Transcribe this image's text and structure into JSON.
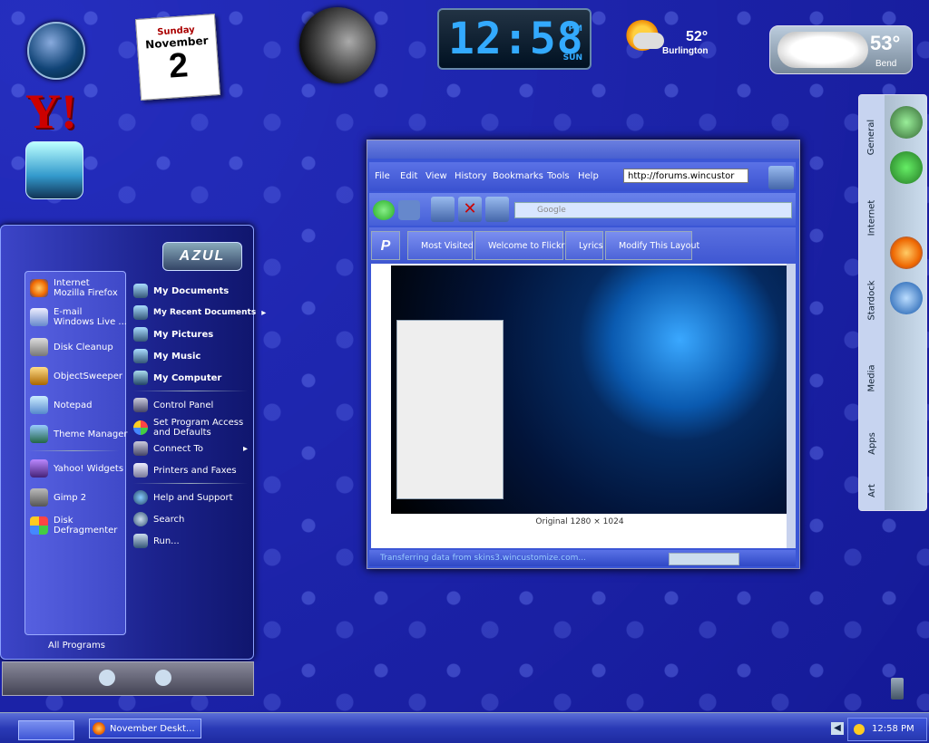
{
  "calendar": {
    "weekday": "Sunday",
    "month": "November",
    "day": "2"
  },
  "clock": {
    "time": "12:58",
    "ampm": "PM",
    "weekday": "SUN"
  },
  "weather_small": {
    "temp": "52°",
    "city": "Burlington"
  },
  "weather_large": {
    "temp": "53°",
    "city": "Bend"
  },
  "start_menu": {
    "logo": "AZUL",
    "left_items": [
      {
        "line1": "Internet",
        "line2": "Mozilla Firefox"
      },
      {
        "line1": "E-mail",
        "line2": "Windows Live ..."
      },
      {
        "line1": "Disk Cleanup",
        "line2": ""
      },
      {
        "line1": "ObjectSweeper",
        "line2": ""
      },
      {
        "line1": "Notepad",
        "line2": ""
      },
      {
        "line1": "Theme Manager",
        "line2": ""
      },
      {
        "line1": "Yahoo! Widgets",
        "line2": ""
      },
      {
        "line1": "Gimp 2",
        "line2": ""
      },
      {
        "line1": "Disk",
        "line2": "Defragmenter"
      }
    ],
    "all_programs": "All Programs",
    "right_items": [
      {
        "label": "My Documents",
        "arrow": ""
      },
      {
        "label": "My Recent Documents",
        "arrow": "▸"
      },
      {
        "label": "My Pictures",
        "arrow": ""
      },
      {
        "label": "My Music",
        "arrow": ""
      },
      {
        "label": "My Computer",
        "arrow": ""
      },
      {
        "label": "Control Panel",
        "arrow": ""
      },
      {
        "label": "Set Program Access",
        "line2": "and Defaults",
        "arrow": ""
      },
      {
        "label": "Connect To",
        "arrow": "▸"
      },
      {
        "label": "Printers and Faxes",
        "arrow": ""
      },
      {
        "label": "Help and Support",
        "arrow": ""
      },
      {
        "label": "Search",
        "arrow": ""
      },
      {
        "label": "Run...",
        "arrow": ""
      }
    ]
  },
  "browser": {
    "menu": [
      "File",
      "Edit",
      "View",
      "History",
      "Bookmarks",
      "Tools",
      "Help"
    ],
    "url": "http://forums.wincustor",
    "search_placeholder": "Google",
    "bookmarks": [
      "Most Visited",
      "Welcome to Flickr!",
      "Lyrics",
      "Modify This Layout"
    ],
    "caption": "Original 1280 × 1024",
    "status": "Transferring data from skins3.wincustomize.com..."
  },
  "sidebar_tabs": [
    "General",
    "Internet",
    "Stardock",
    "Media",
    "Apps",
    "Art"
  ],
  "taskbar": {
    "task_label": "November Deskt...",
    "tray_time": "12:58 PM"
  },
  "colors": {
    "desktop": "#1a1f9a",
    "accent": "#3af"
  }
}
